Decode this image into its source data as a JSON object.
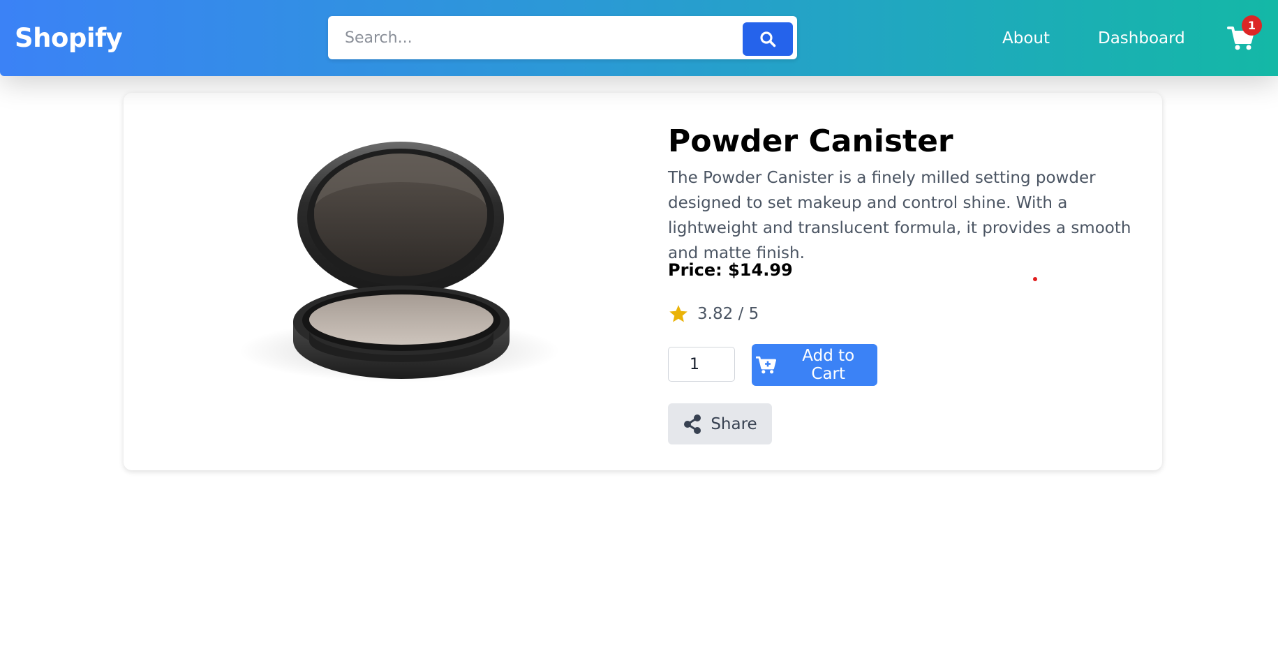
{
  "header": {
    "logo": "Shopify",
    "search_placeholder": "Search...",
    "search_value": "",
    "nav": [
      {
        "label": "About"
      },
      {
        "label": "Dashboard"
      }
    ],
    "cart_count": "1"
  },
  "product": {
    "title": "Powder Canister",
    "description": "The Powder Canister is a finely milled setting powder designed to set makeup and control shine. With a lightweight and translucent formula, it provides a smooth and matte finish.",
    "price_text": "Price: $14.99",
    "rating_text": "3.82 / 5",
    "quantity": "1",
    "add_to_cart_label": "Add to Cart",
    "share_label": "Share"
  },
  "colors": {
    "header_gradient_start": "#3b82f6",
    "header_gradient_end": "#14b8a6",
    "primary": "#3b82f6",
    "search_button": "#2563eb",
    "badge": "#dc2626",
    "star": "#eab308"
  },
  "icons": {
    "search": "search-icon",
    "cart": "cart-icon",
    "cart_plus": "cart-plus-icon",
    "star": "star-icon",
    "share": "share-icon"
  }
}
